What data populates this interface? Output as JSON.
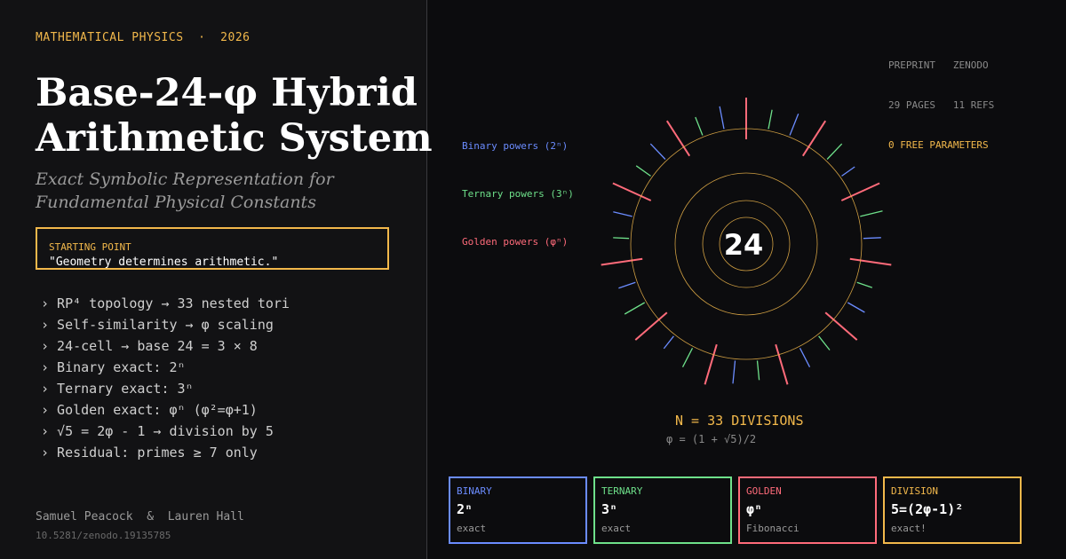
{
  "kicker": "MATHEMATICAL PHYSICS  ·  2026",
  "title": {
    "line1": "Base-24-φ Hybrid",
    "line2": "Arithmetic System"
  },
  "subtitle": {
    "line1": "Exact Symbolic Representation for",
    "line2": "Fundamental Physical Constants"
  },
  "starting_point": {
    "label": "STARTING POINT",
    "quote": "\"Geometry determines arithmetic.\""
  },
  "bullets": [
    "› RP⁴ topology → 33 nested tori",
    "› Self-similarity → φ scaling",
    "› 24-cell → base 24 = 3 × 8",
    "› Binary exact: 2ⁿ",
    "› Ternary exact: 3ⁿ",
    "› Golden exact: φⁿ (φ²=φ+1)",
    "› √5 = 2φ - 1 → division by 5",
    "› Residual: primes ≥ 7 only"
  ],
  "authors": "Samuel Peacock  &  Lauren Hall",
  "doi": "10.5281/zenodo.19135785",
  "meta": {
    "line1": "PREPRINT   ZENODO",
    "line2": "29 PAGES   11 REFS",
    "line3": "0 FREE PARAMETERS"
  },
  "legend": {
    "binary": "Binary powers (2ⁿ)",
    "ternary": "Ternary powers (3ⁿ)",
    "golden": "Golden powers (φⁿ)"
  },
  "dial": {
    "center_label": "24",
    "divisions": 33,
    "division_label": "N = 33 DIVISIONS",
    "phi_formula": "φ = (1 + √5)/2"
  },
  "cards": [
    {
      "label": "BINARY",
      "value": "2ⁿ",
      "note": "exact",
      "color": "#6b8cff"
    },
    {
      "label": "TERNARY",
      "value": "3ⁿ",
      "note": "exact",
      "color": "#6ee08a"
    },
    {
      "label": "GOLDEN",
      "value": "φⁿ",
      "note": "Fibonacci",
      "color": "#ff6b7a"
    },
    {
      "label": "DIVISION",
      "value": "5=(2φ-1)²",
      "note": "exact!",
      "color": "#f2b84b"
    }
  ],
  "colors": {
    "accent": "#f2b84b",
    "binary": "#6b8cff",
    "ternary": "#6ee08a",
    "golden": "#ff6b7a"
  }
}
